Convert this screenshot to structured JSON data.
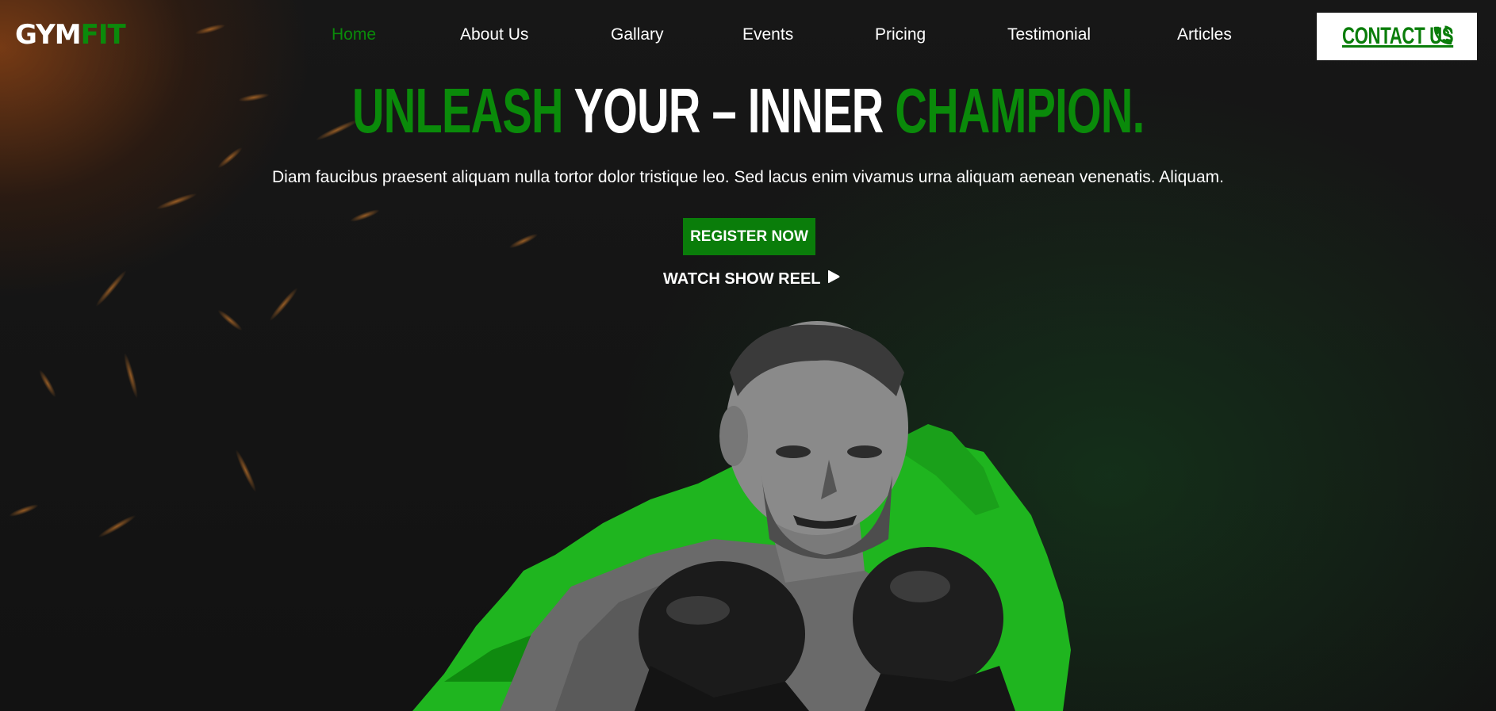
{
  "header": {
    "logo_part1": "GYM",
    "logo_part2": "FIT",
    "nav": [
      {
        "label": "Home",
        "active": true
      },
      {
        "label": "About Us",
        "active": false
      },
      {
        "label": "Gallary",
        "active": false
      },
      {
        "label": "Events",
        "active": false
      },
      {
        "label": "Pricing",
        "active": false
      },
      {
        "label": "Testimonial",
        "active": false
      },
      {
        "label": "Articles",
        "active": false
      }
    ],
    "contact_label": "CONTACT US",
    "contact_icon": "phone-icon"
  },
  "hero": {
    "headline_word1": "UNLEASH",
    "headline_word2": "YOUR – INNER",
    "headline_word3": "CHAMPION.",
    "subtitle": "Diam faucibus praesent aliquam nulla tortor dolor tristique leo. Sed lacus enim vivamus urna aliquam aenean venenatis. Aliquam.",
    "register_label": "REGISTER NOW",
    "reel_label": "WATCH SHOW REEL",
    "reel_icon": "play-icon",
    "image": "boxer-with-gloves-photo"
  },
  "colors": {
    "accent": "#0a8a0a",
    "background": "#151515",
    "text": "#ffffff"
  }
}
